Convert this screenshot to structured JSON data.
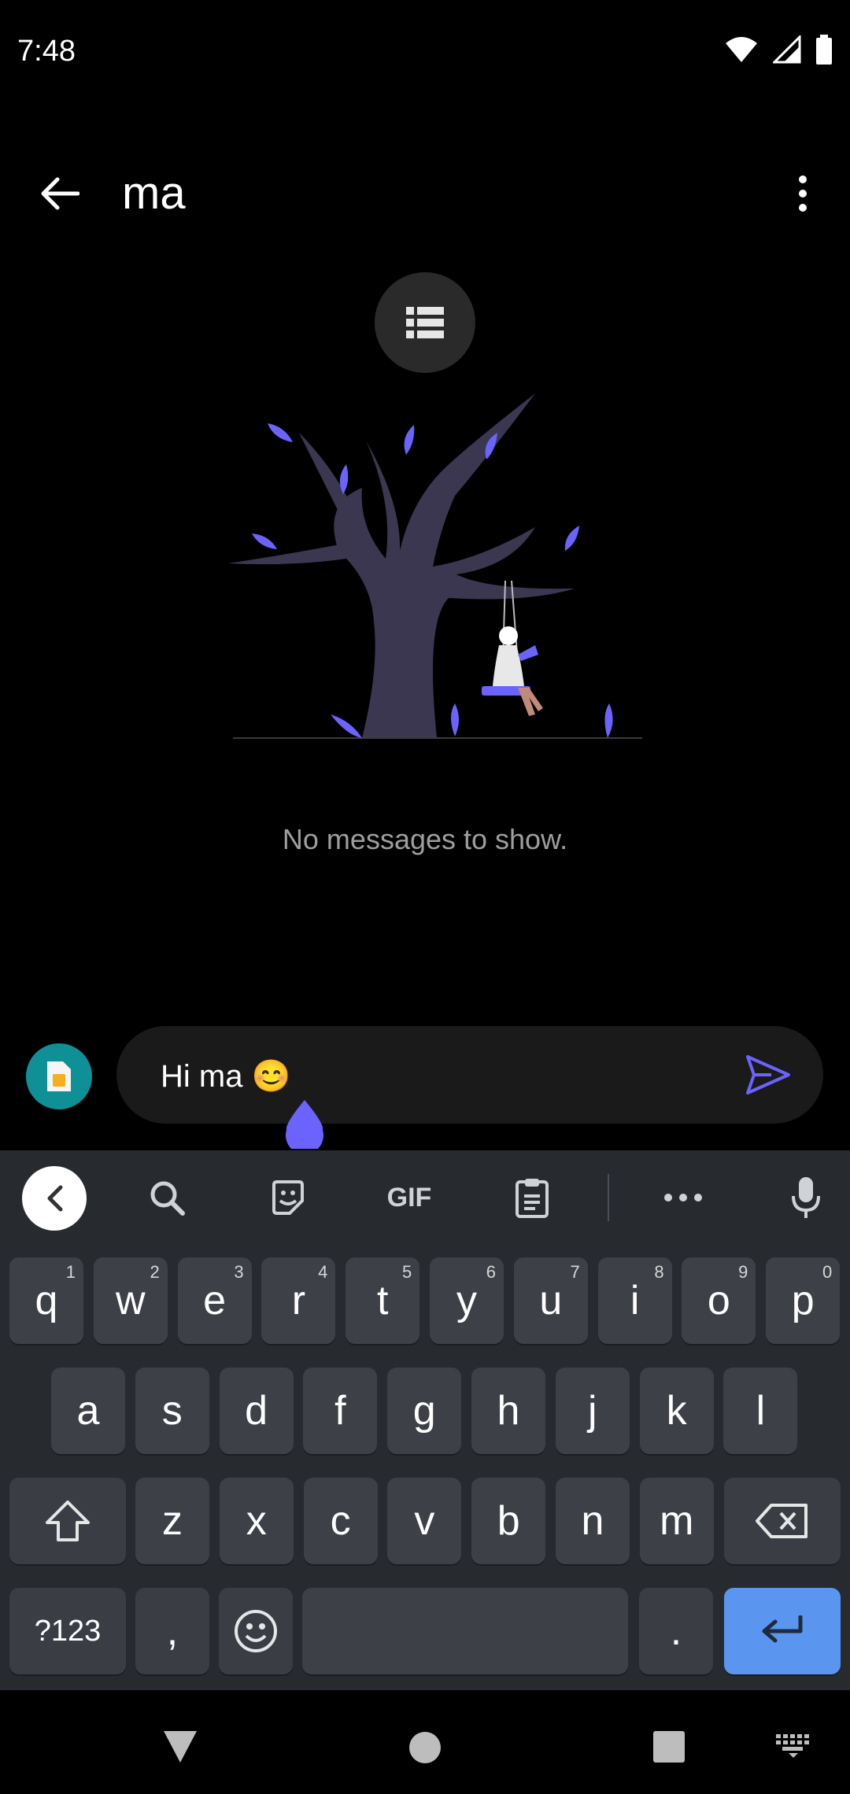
{
  "status_bar": {
    "time": "7:48",
    "icons": [
      "wifi-icon",
      "signal-icon",
      "battery-icon"
    ]
  },
  "toolbar": {
    "title": "ma",
    "back_icon": "arrow-back-icon",
    "more_icon": "more-vert-icon"
  },
  "empty_state": {
    "icon": "list-icon",
    "message": "No messages to show."
  },
  "composer": {
    "sim_icon": "sim-card-icon",
    "text": "Hi ma 😊",
    "send_icon": "send-icon"
  },
  "keyboard": {
    "toolbar_icons": [
      "chevron-left-icon",
      "search-icon",
      "sticker-icon",
      "gif-icon",
      "clipboard-icon",
      "more-horiz-icon",
      "mic-icon"
    ],
    "gif_label": "GIF",
    "row1": [
      {
        "k": "q",
        "h": "1"
      },
      {
        "k": "w",
        "h": "2"
      },
      {
        "k": "e",
        "h": "3"
      },
      {
        "k": "r",
        "h": "4"
      },
      {
        "k": "t",
        "h": "5"
      },
      {
        "k": "y",
        "h": "6"
      },
      {
        "k": "u",
        "h": "7"
      },
      {
        "k": "i",
        "h": "8"
      },
      {
        "k": "o",
        "h": "9"
      },
      {
        "k": "p",
        "h": "0"
      }
    ],
    "row2": [
      "a",
      "s",
      "d",
      "f",
      "g",
      "h",
      "j",
      "k",
      "l"
    ],
    "row3": [
      "z",
      "x",
      "c",
      "v",
      "b",
      "n",
      "m"
    ],
    "symbols_label": "?123",
    "comma": ",",
    "period": "."
  },
  "colors": {
    "accent": "#6c63ff",
    "sim_bg": "#0f8f96",
    "enter_key": "#5a95f0",
    "keyboard_bg": "#272b30"
  }
}
